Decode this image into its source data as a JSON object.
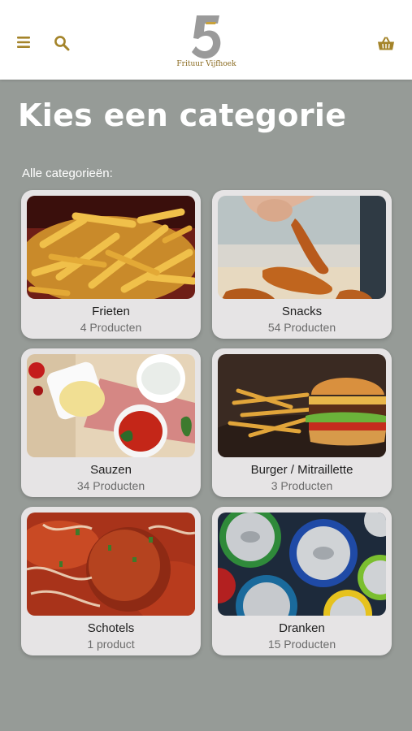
{
  "header": {
    "logo_number": "5",
    "logo_text": "Frituur Vijfhoek",
    "accent_color": "#a4842a"
  },
  "page": {
    "title": "Kies een categorie",
    "section_label": "Alle categorieën:"
  },
  "categories": [
    {
      "name": "Frieten",
      "count": "4 Producten",
      "image": "fries-image"
    },
    {
      "name": "Snacks",
      "count": "54 Producten",
      "image": "snacks-image"
    },
    {
      "name": "Sauzen",
      "count": "34 Producten",
      "image": "sauces-image"
    },
    {
      "name": "Burger / Mitraillette",
      "count": "3 Producten",
      "image": "burger-image"
    },
    {
      "name": "Schotels",
      "count": "1 product",
      "image": "meatball-image"
    },
    {
      "name": "Dranken",
      "count": "15 Producten",
      "image": "cans-image"
    }
  ]
}
